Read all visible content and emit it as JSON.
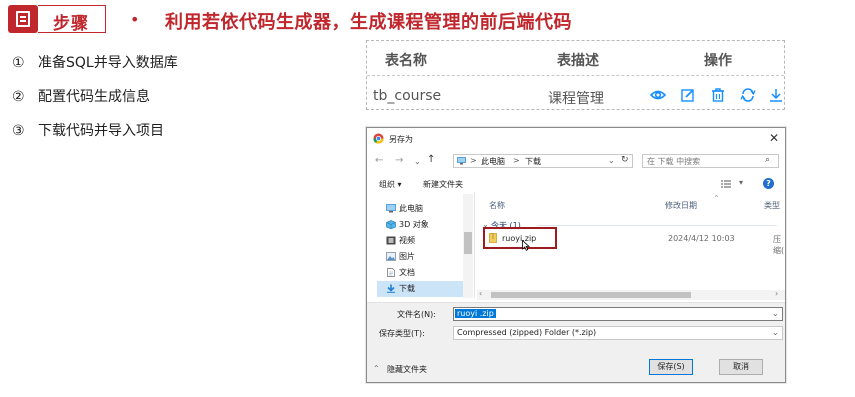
{
  "slide": {
    "step_label": "步骤",
    "bullet": "•",
    "title": "利用若依代码生成器，生成课程管理的前后端代码",
    "steps": [
      {
        "num": "①",
        "text": "准备SQL并导入数据库"
      },
      {
        "num": "②",
        "text": "配置代码生成信息"
      },
      {
        "num": "③",
        "text": "下载代码并导入项目"
      }
    ]
  },
  "codegen_table": {
    "headers": [
      "表名称",
      "表描述",
      "操作"
    ],
    "row": {
      "table_name": "tb_course",
      "table_desc": "课程管理"
    },
    "actions": [
      "preview-icon",
      "edit-icon",
      "delete-icon",
      "sync-icon",
      "download-icon"
    ],
    "icon_color": "#1890ff"
  },
  "dialog": {
    "title": "另存为",
    "address": {
      "root": "此电脑",
      "separator": ">",
      "folder": "下载"
    },
    "search_placeholder": "在 下载 中搜索",
    "toolbar": {
      "organize": "组织 ▾",
      "new_folder": "新建文件夹"
    },
    "nav_items": [
      {
        "label": "此电脑",
        "icon": "computer-icon"
      },
      {
        "label": "3D 对象",
        "icon": "cube-icon"
      },
      {
        "label": "视频",
        "icon": "video-icon"
      },
      {
        "label": "图片",
        "icon": "picture-icon"
      },
      {
        "label": "文档",
        "icon": "document-icon"
      },
      {
        "label": "下载",
        "icon": "download-folder-icon",
        "selected": true
      }
    ],
    "columns": {
      "name": "名称",
      "modified": "修改日期",
      "type": "类型"
    },
    "group": "今天 (1)",
    "file": {
      "name": "ruoyi.zip",
      "modified": "2024/4/12 10:03",
      "type": "压缩("
    },
    "filename_label": "文件名(N):",
    "filename_value": "ruoyi .zip",
    "filetype_label": "保存类型(T):",
    "filetype_value": "Compressed (zipped) Folder (*.zip)",
    "hide_folders": "隐藏文件夹",
    "save": "保存(S)",
    "cancel": "取消",
    "accent": "#0078d7",
    "highlight_color": "#9b1b1f"
  }
}
